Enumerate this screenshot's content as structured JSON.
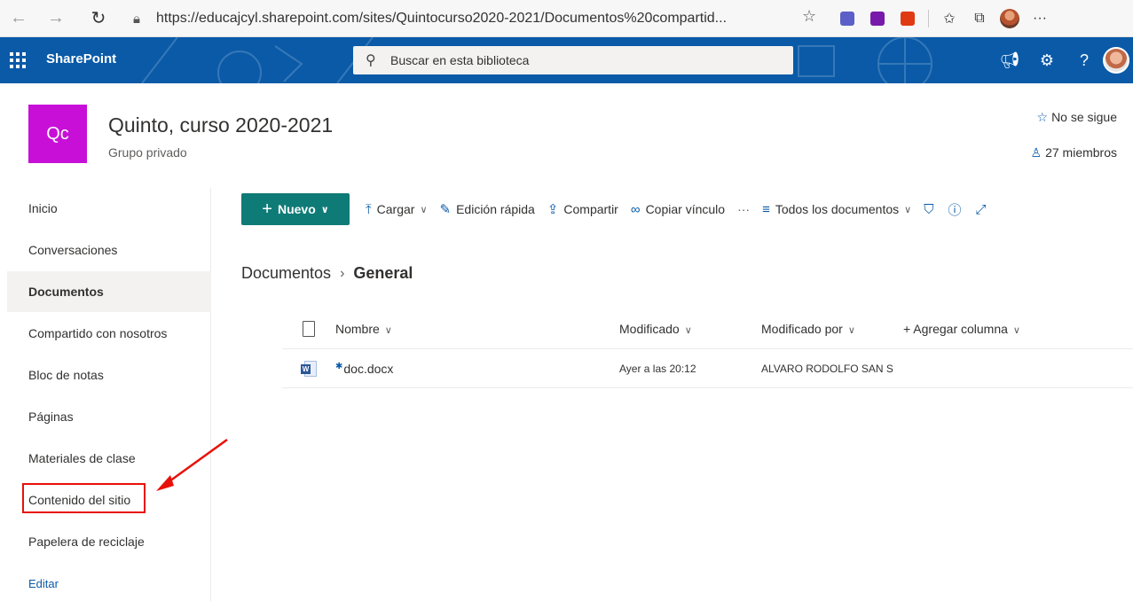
{
  "browser": {
    "url": "https://educajcyl.sharepoint.com/sites/Quintocurso2020-2021/Documentos%20compartid...",
    "back_icon": "arrow-left-icon",
    "forward_icon": "arrow-right-icon",
    "refresh_icon": "refresh-icon",
    "more_label": "···"
  },
  "suite": {
    "brand": "SharePoint",
    "search_placeholder": "Buscar en esta biblioteca",
    "help_label": "?",
    "color": "#0a5aa8"
  },
  "site": {
    "logo_text": "Qc",
    "logo_color": "#c70fd8",
    "title": "Quinto, curso 2020-2021",
    "subtitle": "Grupo privado",
    "follow_label": "No se sigue",
    "members_label": "27 miembros"
  },
  "nav": {
    "items": [
      {
        "label": "Inicio"
      },
      {
        "label": "Conversaciones"
      },
      {
        "label": "Documentos"
      },
      {
        "label": "Compartido con nosotros"
      },
      {
        "label": "Bloc de notas"
      },
      {
        "label": "Páginas"
      },
      {
        "label": "Materiales de clase"
      },
      {
        "label": "Contenido del sitio"
      },
      {
        "label": "Papelera de reciclaje"
      }
    ],
    "edit_label": "Editar"
  },
  "commands": {
    "new_label": "Nuevo",
    "upload_label": "Cargar",
    "quick_edit_label": "Edición rápida",
    "share_label": "Compartir",
    "copy_link_label": "Copiar vínculo",
    "more_label": "···",
    "view_label": "Todos los documentos",
    "accent": "#0f7b77"
  },
  "breadcrumb": {
    "parent": "Documentos",
    "current": "General"
  },
  "list": {
    "headers": {
      "name": "Nombre",
      "modified": "Modificado",
      "modified_by": "Modificado por",
      "add_column": "+ Agregar columna"
    },
    "rows": [
      {
        "name": "doc.docx",
        "modified": "Ayer a las 20:12",
        "modified_by": "ALVARO RODOLFO SAN S",
        "icon": "word-doc-icon"
      }
    ]
  },
  "annotation": {
    "color": "#e8110a"
  }
}
